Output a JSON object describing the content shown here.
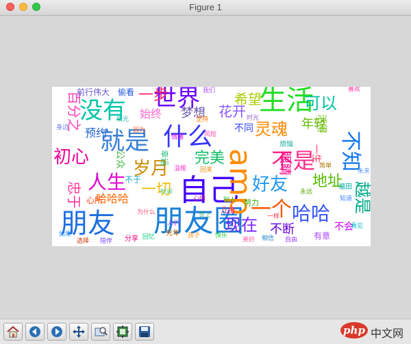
{
  "window": {
    "title": "Figure 1"
  },
  "watermark": {
    "logo_text": "php",
    "site_text": "中文网"
  },
  "toolbar": {
    "buttons": [
      {
        "name": "home-button",
        "icon": "home-icon"
      },
      {
        "name": "back-button",
        "icon": "arrow-left-icon"
      },
      {
        "name": "forward-button",
        "icon": "arrow-right-icon"
      },
      {
        "name": "pan-button",
        "icon": "move-icon"
      },
      {
        "name": "zoom-button",
        "icon": "zoom-rect-icon"
      },
      {
        "name": "subplots-button",
        "icon": "subplots-icon"
      },
      {
        "name": "save-button",
        "icon": "save-icon"
      }
    ]
  },
  "wordcloud": {
    "words": [
      {
        "text": "朋友圈",
        "color": "#1a7fd8"
      },
      {
        "text": "朋友",
        "color": "#1f6fe0"
      },
      {
        "text": "自己",
        "color": "#4400ff"
      },
      {
        "text": "amp",
        "color": "#ff8c00"
      },
      {
        "text": "就是",
        "color": "#3a7fd5"
      },
      {
        "text": "什么",
        "color": "#3333ff"
      },
      {
        "text": "生活",
        "color": "#22dd22"
      },
      {
        "text": "没有",
        "color": "#00c4a8"
      },
      {
        "text": "世界",
        "color": "#6b00ff"
      },
      {
        "text": "不是",
        "color": "#ff2b8a"
      },
      {
        "text": "一个",
        "color": "#ff5500"
      },
      {
        "text": "哈哈",
        "color": "#3355ff"
      },
      {
        "text": "人生",
        "color": "#dd00cc"
      },
      {
        "text": "岁月",
        "color": "#cc8800"
      },
      {
        "text": "好友",
        "color": "#2299ee"
      },
      {
        "text": "现在",
        "color": "#7722ff"
      },
      {
        "text": "初心",
        "color": "#ee0099"
      },
      {
        "text": "完美",
        "color": "#11bb66"
      },
      {
        "text": "灵魂",
        "color": "#ff8800"
      },
      {
        "text": "不知",
        "color": "#1177ee"
      },
      {
        "text": "可以",
        "color": "#00c2a0"
      },
      {
        "text": "希望",
        "color": "#aacc00"
      },
      {
        "text": "百分之",
        "color": "#ff44bb"
      },
      {
        "text": "一步",
        "color": "#ff2266"
      },
      {
        "text": "一切",
        "color": "#eebb00"
      },
      {
        "text": "地址",
        "color": "#55bb00"
      },
      {
        "text": "不断",
        "color": "#6600dd"
      },
      {
        "text": "越是",
        "color": "#00aa88"
      },
      {
        "text": "不会",
        "color": "#cc00ff"
      },
      {
        "text": "花开",
        "color": "#8855ff"
      },
      {
        "text": "年轻",
        "color": "#66bb00"
      },
      {
        "text": "眼睛",
        "color": "#ff0088"
      },
      {
        "text": "忠于",
        "color": "#ff3399"
      },
      {
        "text": "梦想",
        "color": "#6655aa"
      },
      {
        "text": "哈哈哈",
        "color": "#ff6600"
      },
      {
        "text": "始终",
        "color": "#ff66cc"
      },
      {
        "text": "公众",
        "color": "#44bb44"
      },
      {
        "text": "预约",
        "color": "#2266cc"
      },
      {
        "text": "有意",
        "color": "#aa44ff"
      },
      {
        "text": "前行伟大",
        "color": "#6655cc"
      },
      {
        "text": "偷看",
        "color": "#2255dd"
      },
      {
        "text": "不同",
        "color": "#3344ff"
      },
      {
        "text": "一生",
        "color": "#ff3366"
      },
      {
        "text": "活得",
        "color": "#66bb00"
      },
      {
        "text": "不于",
        "color": "#11aacc"
      },
      {
        "text": "努力",
        "color": "#33aa00"
      },
      {
        "text": "几度",
        "color": "#ff2288"
      },
      {
        "text": "心所",
        "color": "#ff4400"
      },
      {
        "text": "幸运",
        "color": "#22bb77"
      },
      {
        "text": "烦恼",
        "color": "#11aa99"
      },
      {
        "text": "福田",
        "color": "#00aaaa"
      },
      {
        "text": "光年",
        "color": "#cc6600"
      },
      {
        "text": "分享",
        "color": "#ee0077"
      },
      {
        "text": "情绪",
        "color": "#cc00ee"
      },
      {
        "text": "时间",
        "color": "#44cc99"
      },
      {
        "text": "风险",
        "color": "#ff44aa"
      },
      {
        "text": "心情",
        "color": "#bb2299"
      },
      {
        "text": "永远",
        "color": "#55aa00"
      },
      {
        "text": "因为",
        "color": "#ff6633"
      },
      {
        "text": "身边",
        "color": "#6677ee"
      },
      {
        "text": "孩子",
        "color": "#ff9922"
      },
      {
        "text": "快乐",
        "color": "#22cc44"
      },
      {
        "text": "自由",
        "color": "#9933ff"
      },
      {
        "text": "看见",
        "color": "#00bbcc"
      },
      {
        "text": "喜欢",
        "color": "#ff2299"
      },
      {
        "text": "知道",
        "color": "#4488ff"
      },
      {
        "text": "我们",
        "color": "#aa55ff"
      },
      {
        "text": "回来",
        "color": "#ee8800"
      },
      {
        "text": "世上",
        "color": "#44aa66"
      },
      {
        "text": "为什么",
        "color": "#ff5577"
      },
      {
        "text": "如果",
        "color": "#3399ff"
      },
      {
        "text": "选择",
        "color": "#cc3300"
      },
      {
        "text": "陪伴",
        "color": "#7744ff"
      },
      {
        "text": "回忆",
        "color": "#00cc77"
      },
      {
        "text": "美好",
        "color": "#ff66aa"
      },
      {
        "text": "相信",
        "color": "#2288cc"
      },
      {
        "text": "坚持",
        "color": "#ff7700"
      },
      {
        "text": "时光",
        "color": "#9966cc"
      },
      {
        "text": "别人",
        "color": "#11bb55"
      },
      {
        "text": "一样",
        "color": "#ff3344"
      },
      {
        "text": "未来",
        "color": "#6699ff"
      },
      {
        "text": "简单",
        "color": "#aa7700"
      },
      {
        "text": "温暖",
        "color": "#ff44cc"
      },
      {
        "text": "阳光",
        "color": "#33bbaa"
      },
      {
        "text": "人们",
        "color": "#bb44ff"
      }
    ]
  }
}
